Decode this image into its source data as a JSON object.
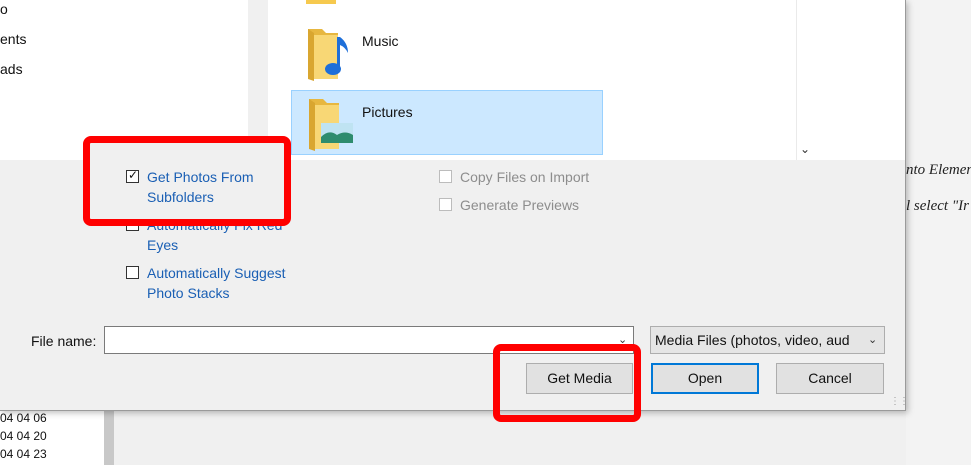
{
  "background": {
    "right_text_line1": "nto Elemen",
    "right_text_line2": "l select \"Ir",
    "left_numbers": [
      "04 04 06",
      "04 04 20",
      "04 04 23"
    ]
  },
  "nav": {
    "items": [
      "o",
      "ents",
      "ads"
    ]
  },
  "file_list": {
    "items": [
      {
        "label": "Music",
        "icon": "music-folder-icon"
      },
      {
        "label": "Pictures",
        "icon": "pictures-folder-icon",
        "selected": true
      }
    ]
  },
  "options": {
    "get_photos_subfolders": {
      "label": "Get Photos From Subfolders",
      "checked": true
    },
    "auto_fix_red_eyes": {
      "label": "Automatically Fix Red Eyes",
      "checked": false
    },
    "auto_suggest_stacks": {
      "label": "Automatically Suggest Photo Stacks",
      "checked": false
    },
    "copy_files_on_import": {
      "label": "Copy Files on Import",
      "checked": false,
      "disabled": true
    },
    "generate_previews": {
      "label": "Generate Previews",
      "checked": false,
      "disabled": true
    }
  },
  "filename": {
    "label": "File name:",
    "value": ""
  },
  "filetype": {
    "selected": "Media Files (photos, video, aud"
  },
  "buttons": {
    "get_media": "Get Media",
    "open": "Open",
    "cancel": "Cancel"
  },
  "colors": {
    "highlight": "#ff0000",
    "link_blue": "#1a5fb4",
    "selection": "#cce8ff",
    "accent": "#0078d7"
  }
}
